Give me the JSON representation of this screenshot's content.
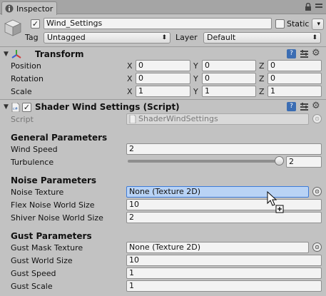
{
  "window": {
    "tab_title": "Inspector",
    "menu_icon": "kebab-menu-icon",
    "lock_icon": "lock-icon"
  },
  "gameobject": {
    "name": "Wind_Settings",
    "active_checked": true,
    "static_label": "Static",
    "static_checked": false,
    "tag_label": "Tag",
    "tag_value": "Untagged",
    "layer_label": "Layer",
    "layer_value": "Default"
  },
  "transform": {
    "title": "Transform",
    "rows": [
      {
        "label": "Position",
        "x": "0",
        "y": "0",
        "z": "0"
      },
      {
        "label": "Rotation",
        "x": "0",
        "y": "0",
        "z": "0"
      },
      {
        "label": "Scale",
        "x": "1",
        "y": "1",
        "z": "1"
      }
    ],
    "axes": [
      "X",
      "Y",
      "Z"
    ]
  },
  "script_component": {
    "title": "Shader Wind Settings (Script)",
    "enabled": true,
    "script_label": "Script",
    "script_value": "ShaderWindSettings"
  },
  "general": {
    "header": "General Parameters",
    "wind_speed_label": "Wind Speed",
    "wind_speed_value": "2",
    "turbulence_label": "Turbulence",
    "turbulence_value": "2",
    "turbulence_fraction": 1.0
  },
  "noise": {
    "header": "Noise Parameters",
    "noise_texture_label": "Noise Texture",
    "noise_texture_value": "None (Texture 2D)",
    "flex_label": "Flex Noise World Size",
    "flex_value": "10",
    "shiver_label": "Shiver Noise World Size",
    "shiver_value": "2"
  },
  "gust": {
    "header": "Gust Parameters",
    "mask_label": "Gust Mask Texture",
    "mask_value": "None (Texture 2D)",
    "world_size_label": "Gust World Size",
    "world_size_value": "10",
    "speed_label": "Gust Speed",
    "speed_value": "1",
    "scale_label": "Gust Scale",
    "scale_value": "1"
  },
  "colors": {
    "background": "#c2c2c2",
    "highlight_field": "#b9d3f5",
    "highlight_border": "#3d7bd9",
    "help_icon": "#3b6db3"
  }
}
